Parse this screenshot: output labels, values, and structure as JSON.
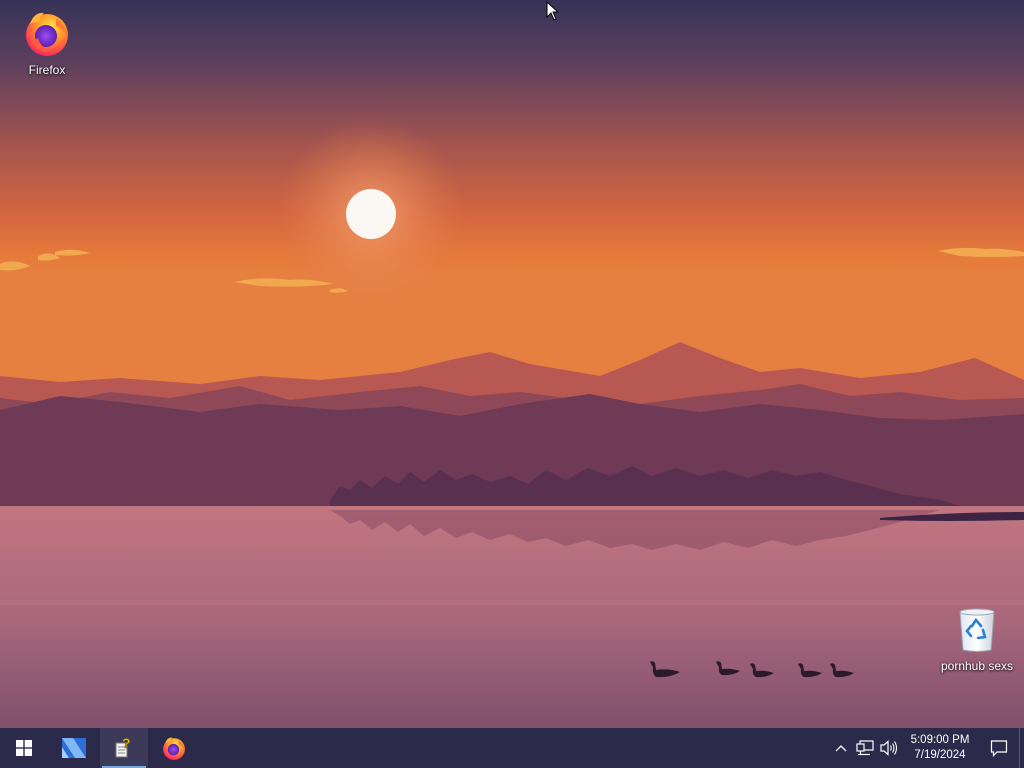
{
  "desktop": {
    "icons": [
      {
        "label": "Firefox",
        "icon": "firefox-icon"
      },
      {
        "label": "pornhub sexs",
        "icon": "recycle-bin-icon"
      }
    ]
  },
  "taskbar": {
    "start_icon": "windows-start-icon",
    "pinned": [
      {
        "icon": "app-icon-blue"
      },
      {
        "icon": "help-document-icon",
        "active": true
      },
      {
        "icon": "firefox-icon"
      }
    ],
    "tray": {
      "icons": [
        "chevron-up-icon",
        "network-icon",
        "volume-icon"
      ],
      "time": "5:09:00 PM",
      "date": "7/19/2024",
      "notification_icon": "action-center-icon"
    }
  },
  "colors": {
    "taskbar_bg": "#2c2a4a",
    "sky_top": "#3a3556",
    "sky_horizon": "#e67b3d",
    "water": "#a8677a"
  }
}
